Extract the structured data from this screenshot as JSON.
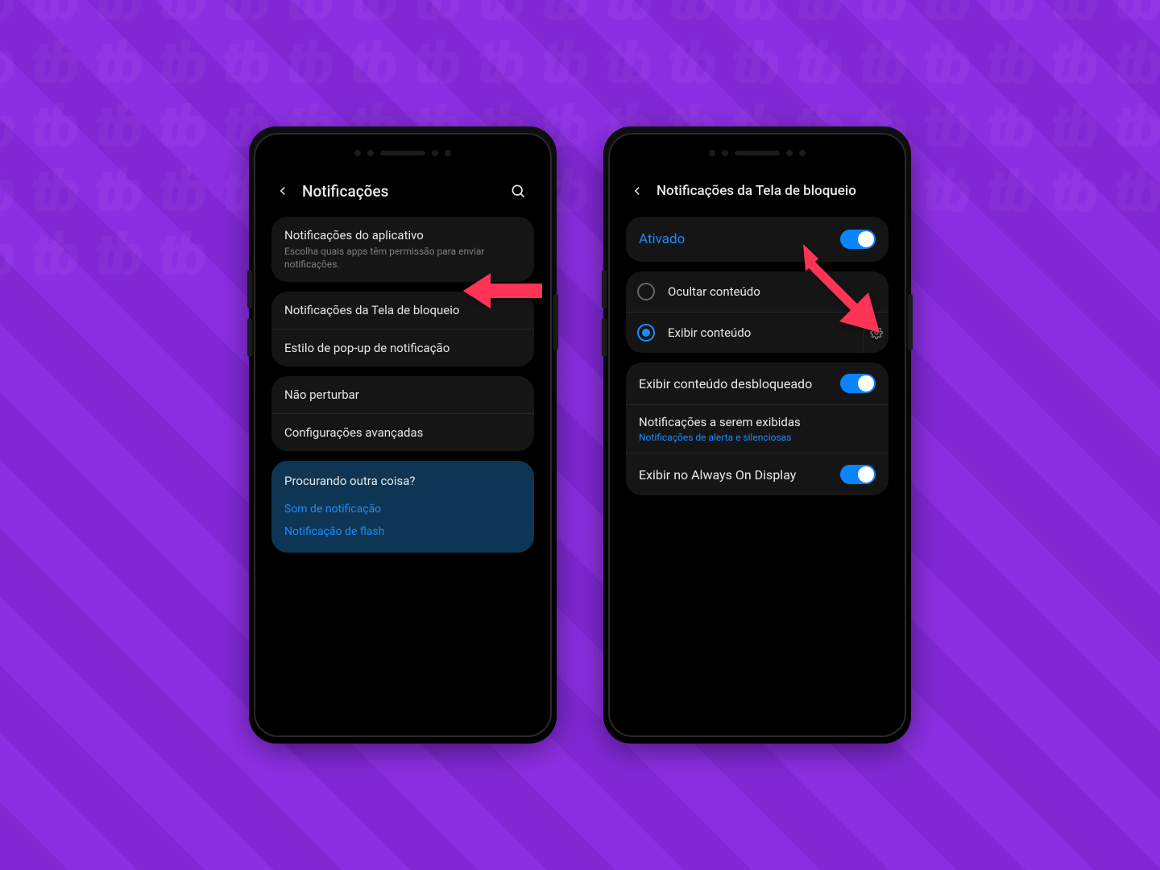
{
  "phone1": {
    "title": "Notificações",
    "group1": {
      "app_notifications": {
        "title": "Notificações do aplicativo",
        "sub": "Escolha quais apps têm permissão para enviar notificações."
      }
    },
    "group2": {
      "lockscreen": "Notificações da Tela de bloqueio",
      "popup_style": "Estilo de pop-up de notificação"
    },
    "group3": {
      "dnd": "Não perturbar",
      "advanced": "Configurações avançadas"
    },
    "looking_for": {
      "title": "Procurando outra coisa?",
      "link1": "Som de notificação",
      "link2": "Notificação de flash"
    }
  },
  "phone2": {
    "title": "Notificações da Tela de bloqueio",
    "activated": "Ativado",
    "radios": {
      "hide": "Ocultar conteúdo",
      "show": "Exibir conteúdo"
    },
    "group2": {
      "unlocked": "Exibir conteúdo desbloqueado",
      "to_show": {
        "title": "Notificações a serem exibidas",
        "sub": "Notificações de alerta e silenciosas"
      },
      "aod": "Exibir no Always On Display"
    }
  }
}
